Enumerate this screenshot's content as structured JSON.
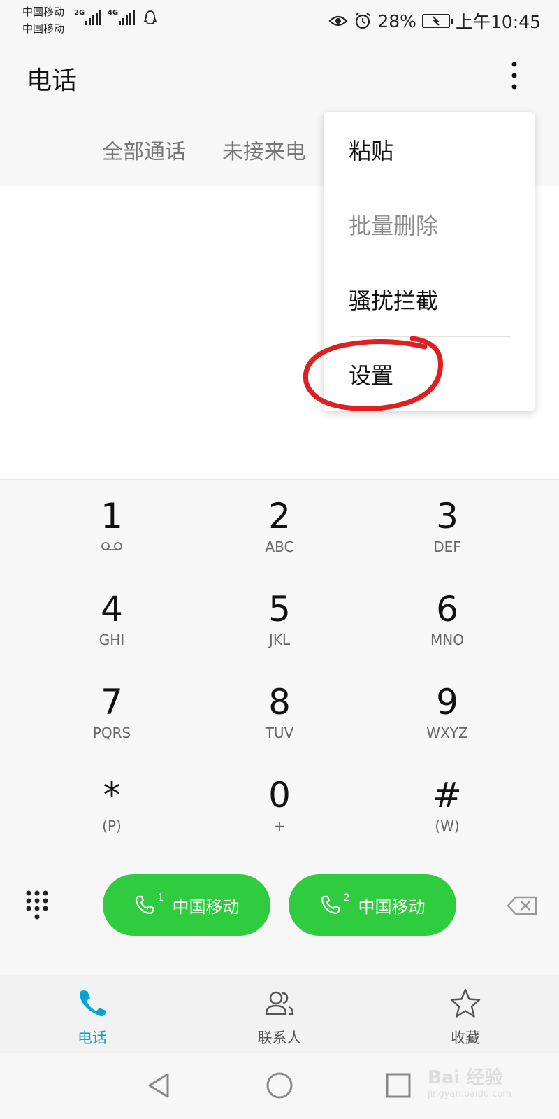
{
  "status_bar": {
    "carrier_1": "中国移动",
    "carrier_2": "中国移动",
    "net_1": "2G",
    "net_2": "4G",
    "battery_percent": "28%",
    "time": "上午10:45"
  },
  "header": {
    "title": "电话",
    "tabs": [
      "全部通话",
      "未接来电"
    ]
  },
  "menu": {
    "items": [
      {
        "label": "粘贴",
        "enabled": true
      },
      {
        "label": "批量删除",
        "enabled": false
      },
      {
        "label": "骚扰拦截",
        "enabled": true
      },
      {
        "label": "设置",
        "enabled": true,
        "highlighted": true
      }
    ],
    "highlight_color": "#e02020"
  },
  "dialpad": {
    "keys": [
      {
        "digit": "1",
        "letters": ""
      },
      {
        "digit": "2",
        "letters": "ABC"
      },
      {
        "digit": "3",
        "letters": "DEF"
      },
      {
        "digit": "4",
        "letters": "GHI"
      },
      {
        "digit": "5",
        "letters": "JKL"
      },
      {
        "digit": "6",
        "letters": "MNO"
      },
      {
        "digit": "7",
        "letters": "PQRS"
      },
      {
        "digit": "8",
        "letters": "TUV"
      },
      {
        "digit": "9",
        "letters": "WXYZ"
      },
      {
        "digit": "*",
        "letters": "(P)"
      },
      {
        "digit": "0",
        "letters": "+"
      },
      {
        "digit": "#",
        "letters": "(W)"
      }
    ]
  },
  "call_buttons": [
    {
      "sim": "1",
      "label": "中国移动"
    },
    {
      "sim": "2",
      "label": "中国移动"
    }
  ],
  "bottom_nav": {
    "phone": "电话",
    "contacts": "联系人",
    "favorites": "收藏"
  },
  "colors": {
    "accent": "#00a5d6",
    "call_green": "#2fcc3f"
  },
  "watermark": {
    "line1": "Bai 经验",
    "line2": "jingyan.baidu.com"
  }
}
